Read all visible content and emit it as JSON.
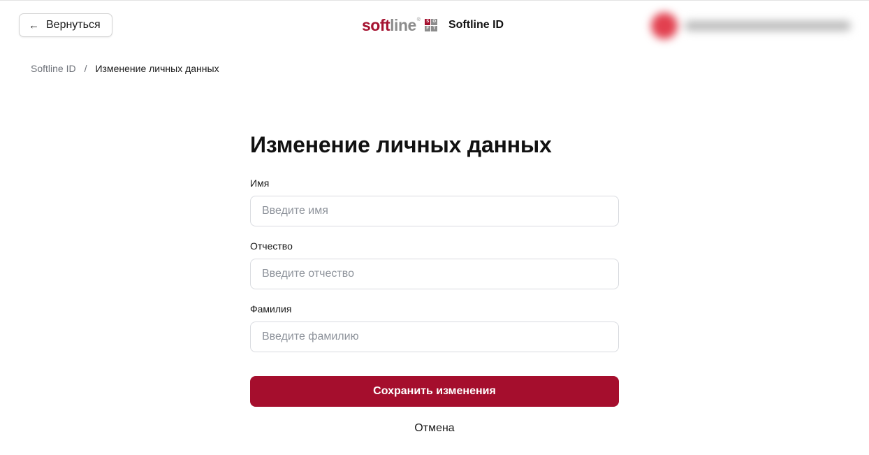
{
  "header": {
    "back_label": "Вернуться",
    "back_icon": "arrow-left-icon",
    "logo": {
      "text_soft": "soft",
      "text_line": "line",
      "registered": "®",
      "tiles": [
        "S",
        "O",
        "F",
        "T"
      ]
    },
    "title": "Softline ID",
    "user": {
      "avatar_icon": "avatar",
      "email": ""
    }
  },
  "breadcrumb": {
    "root": "Softline ID",
    "separator": "/",
    "current": "Изменение личных данных"
  },
  "form": {
    "title": "Изменение личных данных",
    "fields": [
      {
        "label": "Имя",
        "placeholder": "Введите имя",
        "value": ""
      },
      {
        "label": "Отчество",
        "placeholder": "Введите отчество",
        "value": ""
      },
      {
        "label": "Фамилия",
        "placeholder": "Введите фамилию",
        "value": ""
      }
    ],
    "save_label": "Сохранить изменения",
    "cancel_label": "Отмена"
  },
  "colors": {
    "brand_red": "#a51230",
    "button_red": "#a50e2d",
    "logo_grey": "#8c8c8c",
    "placeholder_grey": "#8e939b",
    "border_grey": "#d9dbe0"
  }
}
